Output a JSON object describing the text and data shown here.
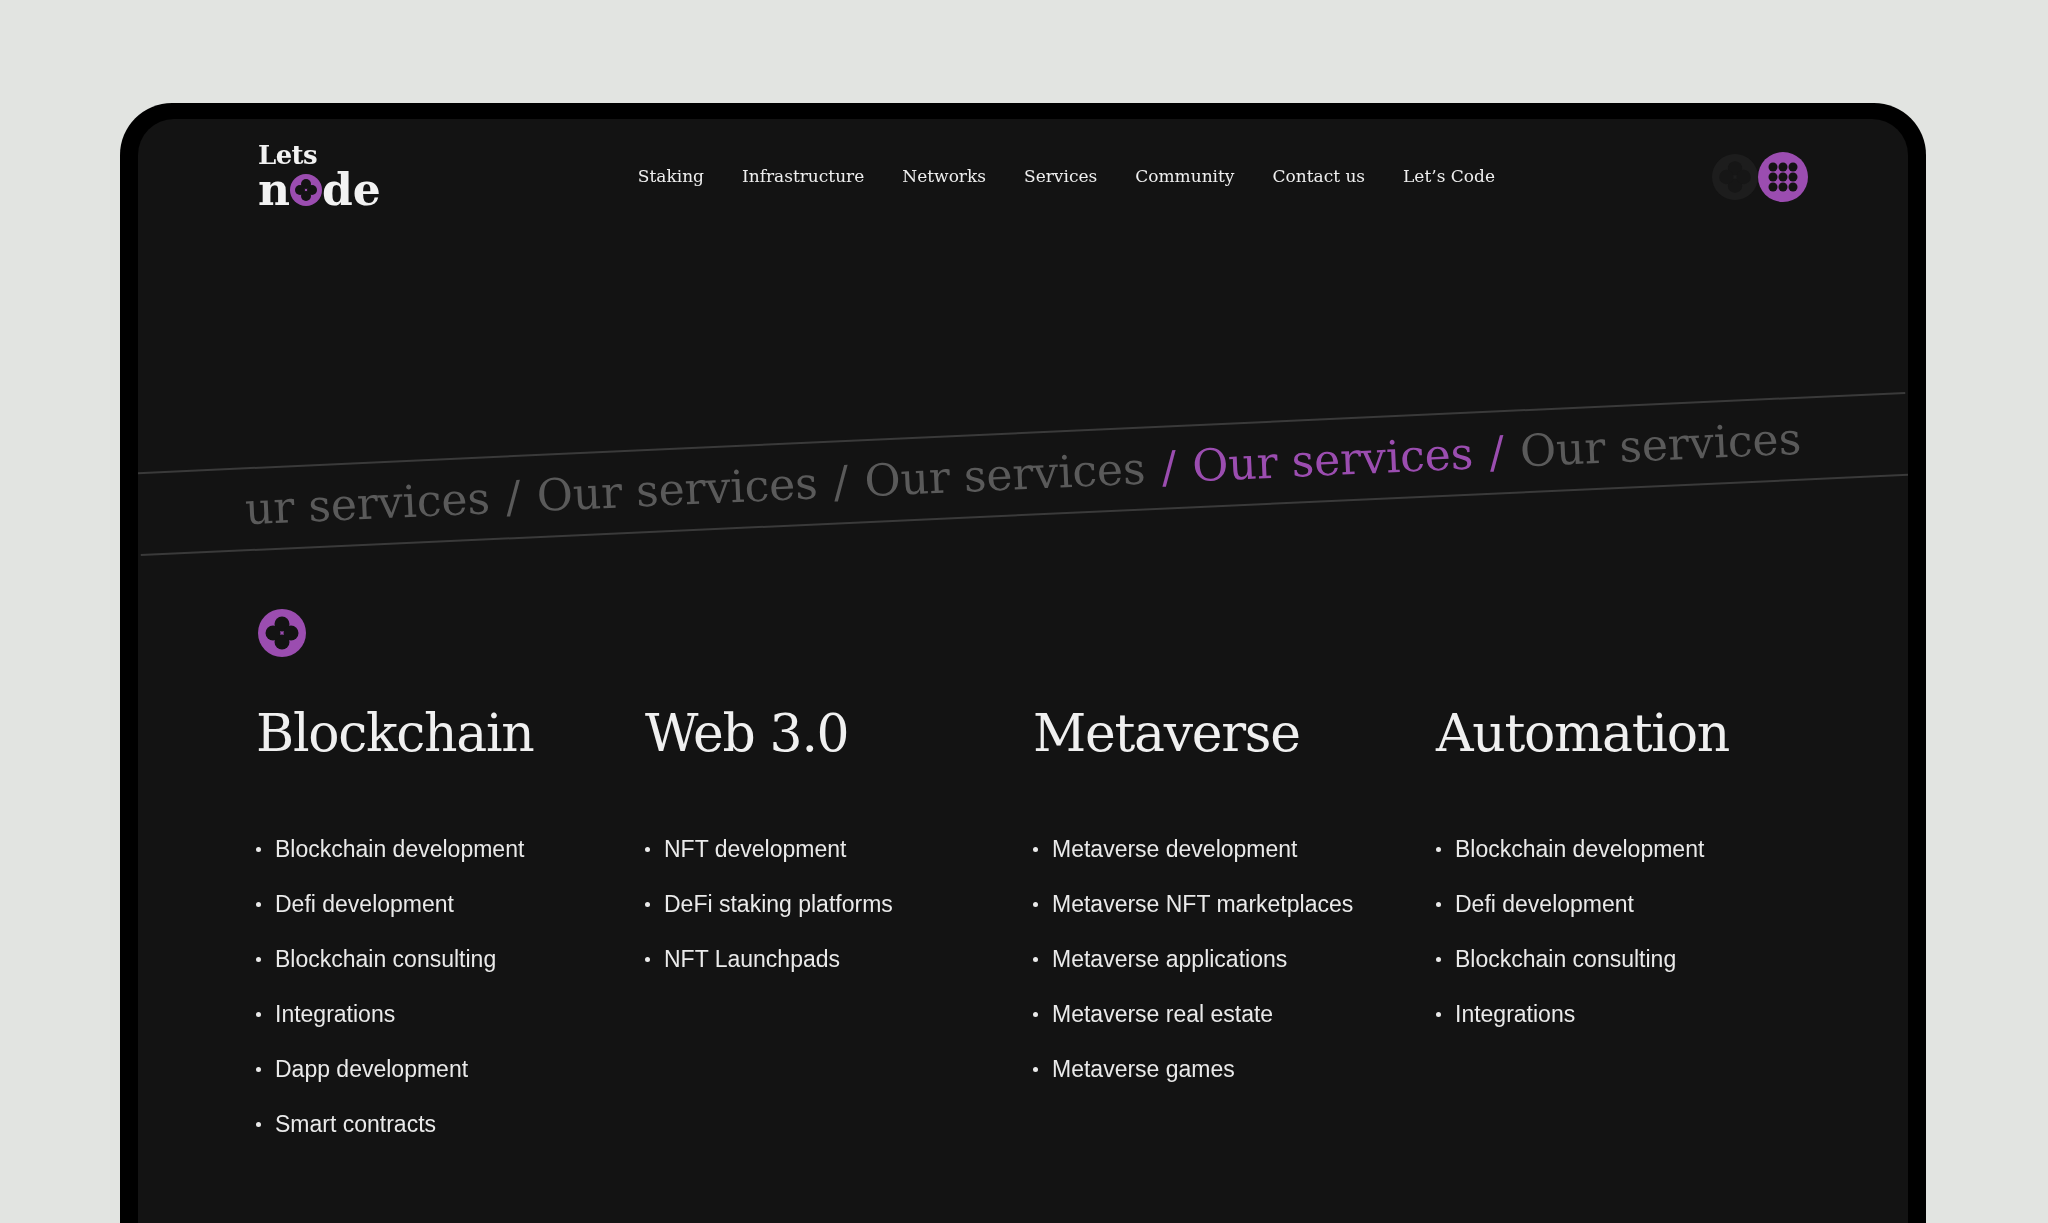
{
  "logo": {
    "top": "Lets",
    "bottom_start": "n",
    "bottom_end": "de"
  },
  "nav": [
    "Staking",
    "Infrastructure",
    "Networks",
    "Services",
    "Community",
    "Contact us",
    "Let’s Code"
  ],
  "marquee": [
    {
      "text": "ur services",
      "highlighted": false
    },
    {
      "text": "/",
      "highlighted": false
    },
    {
      "text": "Our services",
      "highlighted": false
    },
    {
      "text": "/",
      "highlighted": false
    },
    {
      "text": "Our services",
      "highlighted": false
    },
    {
      "text": "/",
      "highlighted": true
    },
    {
      "text": "Our services",
      "highlighted": true
    },
    {
      "text": "/",
      "highlighted": true
    },
    {
      "text": "Our services",
      "highlighted": false
    }
  ],
  "columns": [
    {
      "title": "Blockchain",
      "items": [
        "Blockchain development",
        "Defi development",
        "Blockchain consulting",
        "Integrations",
        "Dapp development",
        "Smart contracts"
      ]
    },
    {
      "title": "Web 3.0",
      "items": [
        "NFT development",
        "DeFi staking platforms",
        "NFT Launchpads"
      ]
    },
    {
      "title": "Metaverse",
      "items": [
        "Metaverse development",
        "Metaverse NFT marketplaces",
        "Metaverse applications",
        "Metaverse real estate",
        "Metaverse games"
      ]
    },
    {
      "title": "Automation",
      "items": [
        "Blockchain development",
        "Defi development",
        "Blockchain consulting",
        "Integrations"
      ]
    }
  ]
}
